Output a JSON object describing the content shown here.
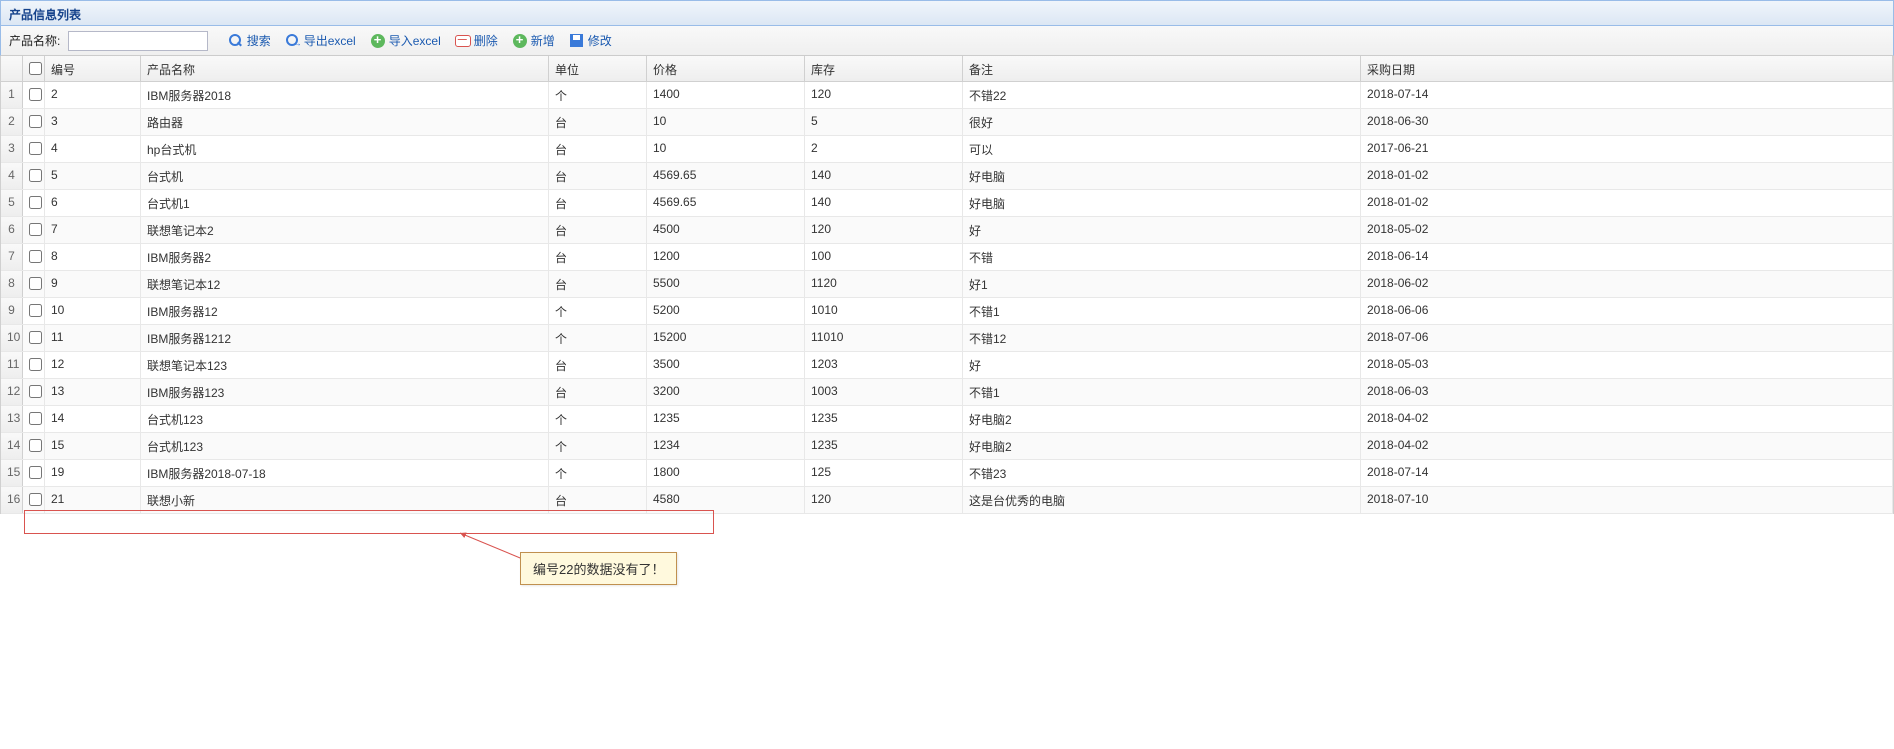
{
  "panel": {
    "title": "产品信息列表"
  },
  "toolbar": {
    "label_product_name": "产品名称:",
    "search_value": "",
    "btn_search": "搜索",
    "btn_export_excel": "导出excel",
    "btn_import_excel": "导入excel",
    "btn_delete": "删除",
    "btn_add": "新增",
    "btn_edit": "修改"
  },
  "columns": {
    "rownum": "",
    "check": "",
    "id": "编号",
    "name": "产品名称",
    "unit": "单位",
    "price": "价格",
    "stock": "库存",
    "remark": "备注",
    "date": "采购日期"
  },
  "rows": [
    {
      "rn": "1",
      "id": "2",
      "name": "IBM服务器2018",
      "unit": "个",
      "price": "1400",
      "stock": "120",
      "remark": "不错22",
      "date": "2018-07-14"
    },
    {
      "rn": "2",
      "id": "3",
      "name": "路由器",
      "unit": "台",
      "price": "10",
      "stock": "5",
      "remark": "很好",
      "date": "2018-06-30"
    },
    {
      "rn": "3",
      "id": "4",
      "name": "hp台式机",
      "unit": "台",
      "price": "10",
      "stock": "2",
      "remark": "可以",
      "date": "2017-06-21"
    },
    {
      "rn": "4",
      "id": "5",
      "name": "台式机",
      "unit": "台",
      "price": "4569.65",
      "stock": "140",
      "remark": "好电脑",
      "date": "2018-01-02"
    },
    {
      "rn": "5",
      "id": "6",
      "name": "台式机1",
      "unit": "台",
      "price": "4569.65",
      "stock": "140",
      "remark": "好电脑",
      "date": "2018-01-02"
    },
    {
      "rn": "6",
      "id": "7",
      "name": "联想笔记本2",
      "unit": "台",
      "price": "4500",
      "stock": "120",
      "remark": "好",
      "date": "2018-05-02"
    },
    {
      "rn": "7",
      "id": "8",
      "name": "IBM服务器2",
      "unit": "台",
      "price": "1200",
      "stock": "100",
      "remark": "不错",
      "date": "2018-06-14"
    },
    {
      "rn": "8",
      "id": "9",
      "name": "联想笔记本12",
      "unit": "台",
      "price": "5500",
      "stock": "1120",
      "remark": "好1",
      "date": "2018-06-02"
    },
    {
      "rn": "9",
      "id": "10",
      "name": "IBM服务器12",
      "unit": "个",
      "price": "5200",
      "stock": "1010",
      "remark": "不错1",
      "date": "2018-06-06"
    },
    {
      "rn": "10",
      "id": "11",
      "name": "IBM服务器1212",
      "unit": "个",
      "price": "15200",
      "stock": "11010",
      "remark": "不错12",
      "date": "2018-07-06"
    },
    {
      "rn": "11",
      "id": "12",
      "name": "联想笔记本123",
      "unit": "台",
      "price": "3500",
      "stock": "1203",
      "remark": "好",
      "date": "2018-05-03"
    },
    {
      "rn": "12",
      "id": "13",
      "name": "IBM服务器123",
      "unit": "台",
      "price": "3200",
      "stock": "1003",
      "remark": "不错1",
      "date": "2018-06-03"
    },
    {
      "rn": "13",
      "id": "14",
      "name": "台式机123",
      "unit": "个",
      "price": "1235",
      "stock": "1235",
      "remark": "好电脑2",
      "date": "2018-04-02"
    },
    {
      "rn": "14",
      "id": "15",
      "name": "台式机123",
      "unit": "个",
      "price": "1234",
      "stock": "1235",
      "remark": "好电脑2",
      "date": "2018-04-02"
    },
    {
      "rn": "15",
      "id": "19",
      "name": "IBM服务器2018-07-18",
      "unit": "个",
      "price": "1800",
      "stock": "125",
      "remark": "不错23",
      "date": "2018-07-14"
    },
    {
      "rn": "16",
      "id": "21",
      "name": "联想小新",
      "unit": "台",
      "price": "4580",
      "stock": "120",
      "remark": "这是台优秀的电脑",
      "date": "2018-07-10"
    }
  ],
  "annotation": {
    "callout_text": "编号22的数据没有了！"
  }
}
